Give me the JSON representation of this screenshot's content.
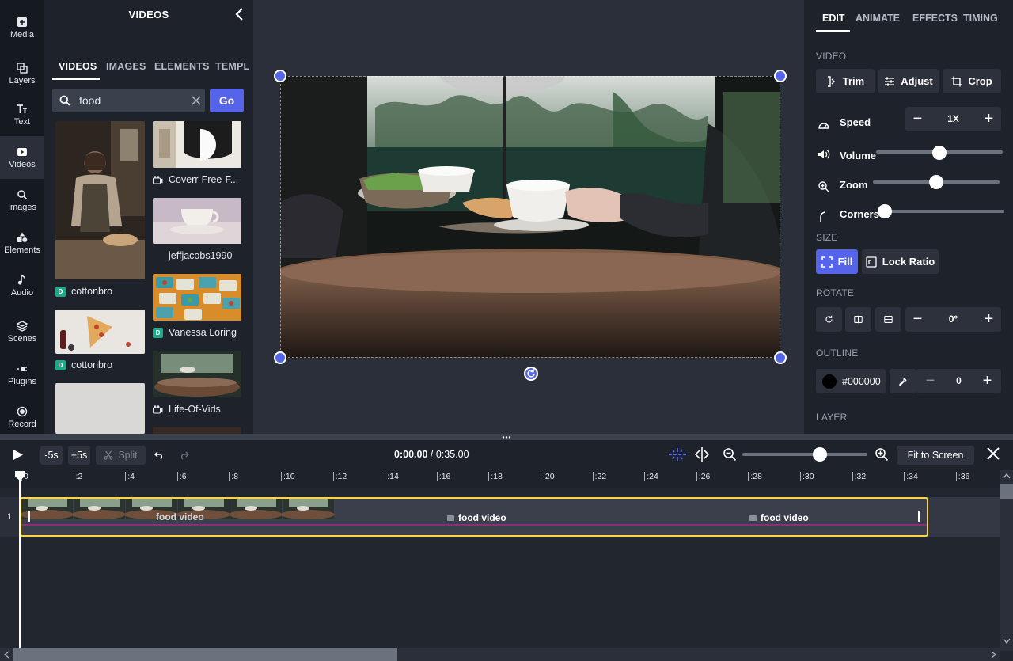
{
  "rail": {
    "items": [
      {
        "label": "Media",
        "icon": "media-add-icon"
      },
      {
        "label": "Layers",
        "icon": "layers-icon"
      },
      {
        "label": "Text",
        "icon": "text-icon"
      },
      {
        "label": "Videos",
        "icon": "video-icon"
      },
      {
        "label": "Images",
        "icon": "image-search-icon"
      },
      {
        "label": "Elements",
        "icon": "shapes-icon"
      },
      {
        "label": "Audio",
        "icon": "music-note-icon"
      },
      {
        "label": "Scenes",
        "icon": "stack-icon"
      },
      {
        "label": "Plugins",
        "icon": "plug-icon"
      },
      {
        "label": "Record",
        "icon": "record-icon"
      }
    ],
    "active": "Videos"
  },
  "library": {
    "title": "VIDEOS",
    "tabs": [
      "VIDEOS",
      "IMAGES",
      "ELEMENTS",
      "TEMPL"
    ],
    "search_value": "food",
    "go_label": "Go",
    "results": [
      {
        "label": "cottonbro",
        "source": "pexels"
      },
      {
        "label": "Coverr-Free-F...",
        "source": "coverr"
      },
      {
        "label": "jeffjacobs1990",
        "source": "none"
      },
      {
        "label": "cottonbro",
        "source": "pexels"
      },
      {
        "label": "Vanessa Loring",
        "source": "pexels"
      },
      {
        "label": "Life-Of-Vids",
        "source": "coverr"
      }
    ]
  },
  "properties": {
    "tabs": [
      "EDIT",
      "ANIMATE",
      "EFFECTS",
      "TIMING"
    ],
    "video_section": "VIDEO",
    "trim_label": "Trim",
    "adjust_label": "Adjust",
    "crop_label": "Crop",
    "speed_label": "Speed",
    "speed_value": "1X",
    "volume_label": "Volume",
    "volume_level": 0.5,
    "zoom_label": "Zoom",
    "zoom_level": 0.5,
    "corners_label": "Corners",
    "corners_level": 0,
    "size_section": "SIZE",
    "fill_label": "Fill",
    "lock_ratio_label": "Lock Ratio",
    "rotate_section": "ROTATE",
    "rotate_value": "0°",
    "outline_section": "OUTLINE",
    "outline_color": "#000000",
    "outline_width": "0",
    "layer_section": "LAYER"
  },
  "timeline": {
    "back5": "-5s",
    "fwd5": "+5s",
    "split_label": "Split",
    "current_time": "0:00.00",
    "total_time": "/ 0:35.00",
    "zoom_level": 0.62,
    "fit_label": "Fit to Screen",
    "ruler": [
      "0",
      ":2",
      ":4",
      ":6",
      ":8",
      ":10",
      ":12",
      ":14",
      ":16",
      ":18",
      ":20",
      ":22",
      ":24",
      ":26",
      ":28",
      ":30",
      ":32",
      ":34",
      ":36"
    ],
    "track_number": "1",
    "clip_labels": [
      "food video",
      "food video",
      "food video"
    ]
  },
  "colors": {
    "accent": "#5564e8",
    "clip_border": "#f3d64b",
    "clip_line": "#8e2c7c",
    "badge": "#1fa88a"
  }
}
